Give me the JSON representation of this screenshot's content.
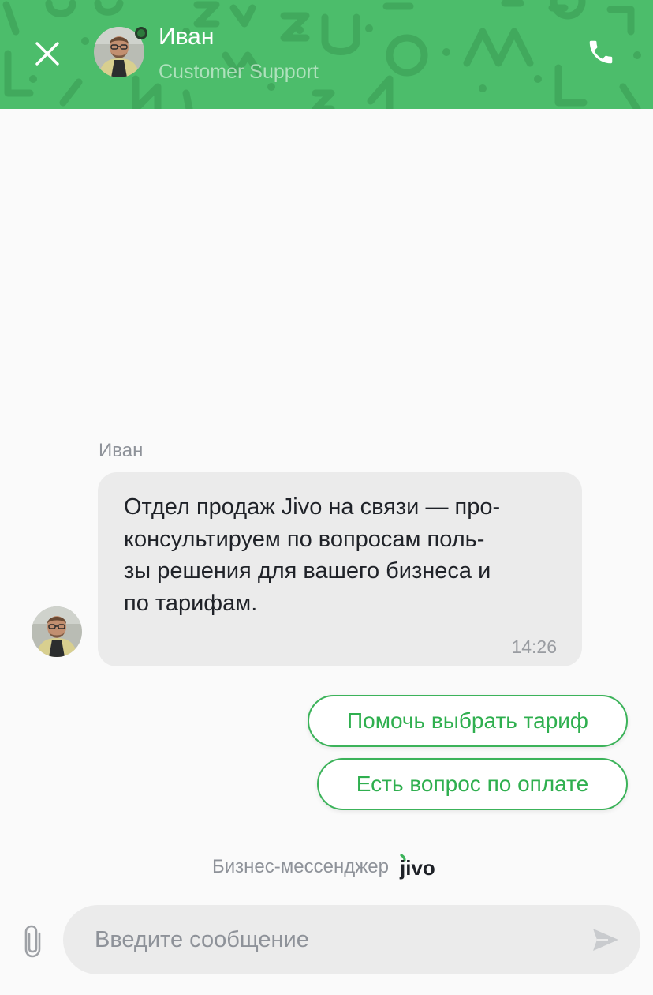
{
  "header": {
    "agent_name": "Иван",
    "agent_role": "Customer Support",
    "background_color": "#4cbd6b",
    "close_icon": "close-icon",
    "call_icon": "phone-icon",
    "online_status": "online"
  },
  "conversation": {
    "messages": [
      {
        "sender": "Иван",
        "lines": [
          "Отдел продаж Jivo на связи — про-",
          "консультируем по вопросам поль-",
          "зы решения для вашего бизнеса и",
          "по тарифам."
        ],
        "time": "14:26"
      }
    ],
    "quick_replies": [
      "Помочь выбрать тариф",
      "Есть вопрос по оплате"
    ]
  },
  "branding": {
    "text": "Бизнес-мессенджер",
    "logo_text": "jivo",
    "logo_accent_color": "#3cb35a"
  },
  "composer": {
    "placeholder": "Введите сообщение",
    "attach_icon": "paperclip-icon",
    "send_icon": "send-icon"
  },
  "colors": {
    "accent": "#3cb35a",
    "bubble": "#ebebeb",
    "background": "#fafafa"
  }
}
